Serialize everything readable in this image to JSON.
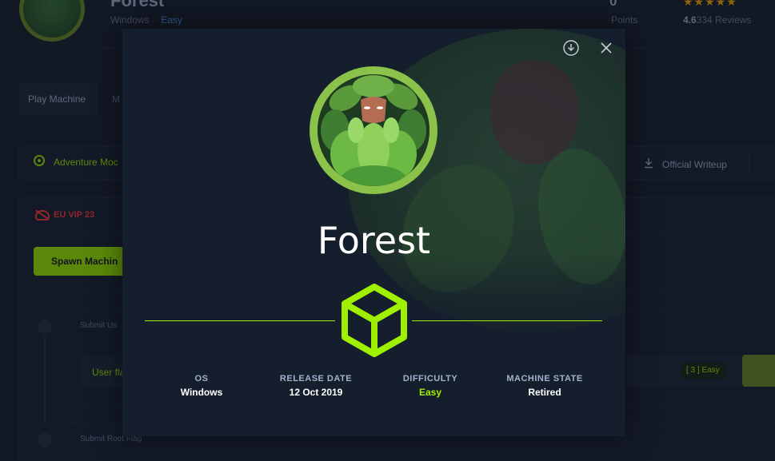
{
  "background": {
    "machine_title": "Forest",
    "os": "Windows",
    "separator": "·",
    "difficulty": "Easy",
    "points_value": "0",
    "points_label": "Points",
    "rating_stars": "★★★★★",
    "rating_value": "4.6",
    "reviews": "334 Reviews",
    "tabs": [
      "Play Machine",
      "M"
    ],
    "adventure_mode": "Adventure Moc",
    "official_writeup": "Official Writeup",
    "vpn_server": "EU VIP 23",
    "spawn_button": "Spawn Machin",
    "submit_user": "Submit Us",
    "user_flag": "User fla",
    "flag_badge": "[ 3 ] Easy",
    "submit_root": "Submit Root Flag"
  },
  "modal": {
    "name": "Forest",
    "stats": [
      {
        "label": "OS",
        "value": "Windows"
      },
      {
        "label": "RELEASE DATE",
        "value": "12 Oct 2019"
      },
      {
        "label": "DIFFICULTY",
        "value": "Easy"
      },
      {
        "label": "MACHINE STATE",
        "value": "Retired"
      }
    ]
  },
  "colors": {
    "accent_green": "#9fef00",
    "background": "#1a2332",
    "modal_background": "#151e2d",
    "text_muted": "#a4b1cd",
    "vip_red": "#ff3e3e",
    "star": "#ffaf00"
  },
  "icons": {
    "download": "download-icon",
    "close": "close-icon",
    "cube": "cube-icon",
    "adventure": "radio-icon",
    "writeup": "download-icon",
    "vpn": "cloud-off-icon"
  }
}
